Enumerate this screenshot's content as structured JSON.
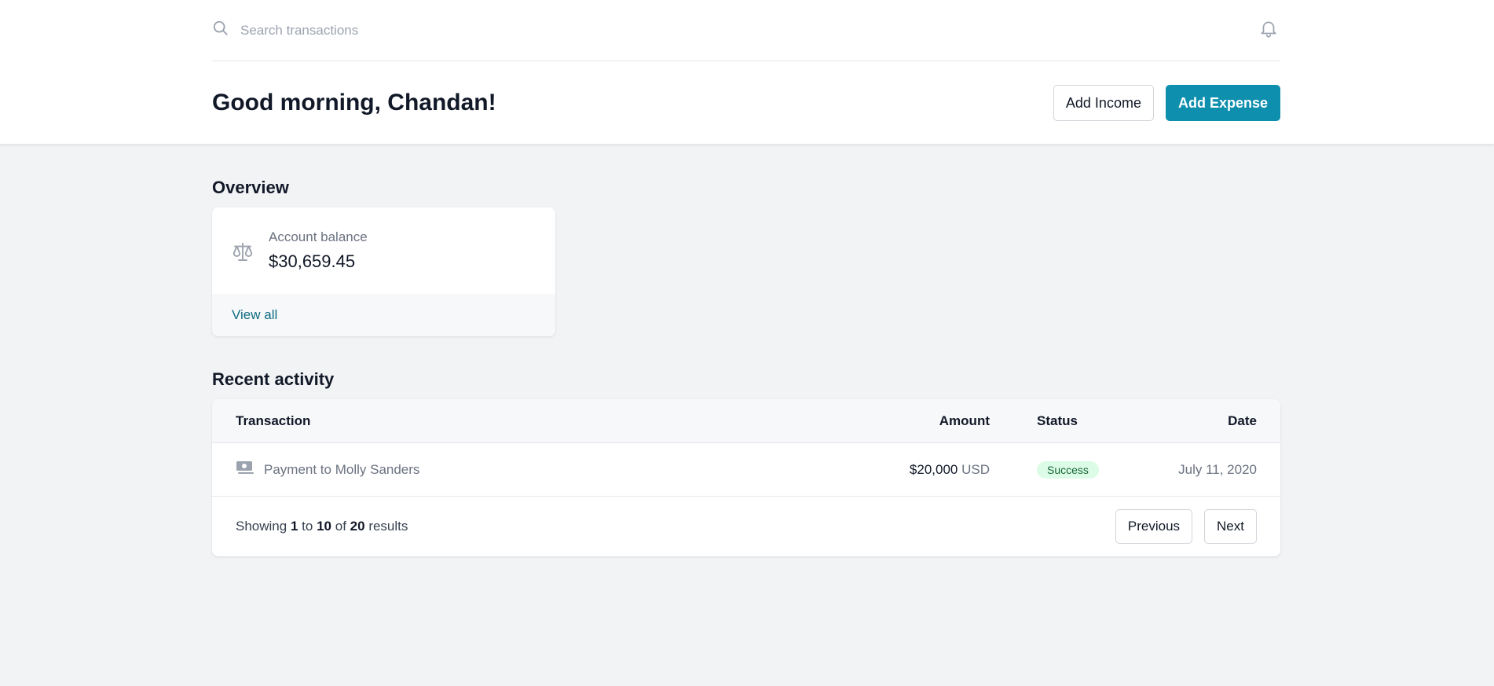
{
  "search": {
    "placeholder": "Search transactions"
  },
  "header": {
    "greeting": "Good morning, Chandan!",
    "add_income_label": "Add Income",
    "add_expense_label": "Add Expense"
  },
  "overview": {
    "title": "Overview",
    "account_balance_label": "Account balance",
    "account_balance_value": "$30,659.45",
    "view_all_label": "View all"
  },
  "activity": {
    "title": "Recent activity",
    "columns": {
      "transaction": "Transaction",
      "amount": "Amount",
      "status": "Status",
      "date": "Date"
    },
    "rows": [
      {
        "transaction": "Payment to Molly Sanders",
        "amount": "$20,000",
        "currency": "USD",
        "status": "Success",
        "date": "July 11, 2020"
      }
    ],
    "pagination": {
      "showing": "Showing",
      "from": "1",
      "to_word": "to",
      "to": "10",
      "of_word": "of",
      "total": "20",
      "results_word": "results",
      "previous_label": "Previous",
      "next_label": "Next"
    }
  },
  "colors": {
    "accent": "#0e8fae",
    "link": "#0e6c82",
    "success_bg": "#dcfce7",
    "success_text": "#166534"
  },
  "icons": [
    "search-icon",
    "bell-icon",
    "scale-icon",
    "cash-icon"
  ]
}
